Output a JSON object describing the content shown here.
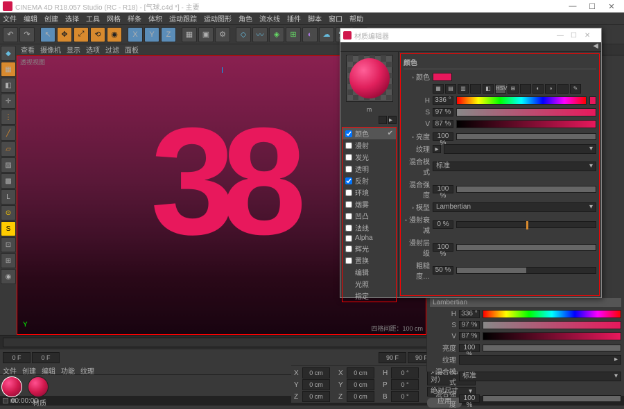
{
  "window": {
    "title": "CINEMA 4D R18.057 Studio (RC - R18) - [气球.c4d *] - 主要"
  },
  "menu": [
    "文件",
    "编辑",
    "创建",
    "选择",
    "工具",
    "网格",
    "样条",
    "体积",
    "运动跟踪",
    "运动图形",
    "角色",
    "流水线",
    "插件",
    "脚本",
    "窗口",
    "帮助"
  ],
  "viewport": {
    "tabs": [
      "查看",
      "摄像机",
      "显示",
      "选项",
      "过滤",
      "面板"
    ],
    "label": "透视视图",
    "frame_span": "四格间距：100 cm"
  },
  "timeline": {
    "start": "0 F",
    "current": "0 F",
    "end": "90 F",
    "end2": "90 F"
  },
  "materials": {
    "tabs": [
      "文件",
      "创建",
      "编辑",
      "功能",
      "纹理"
    ],
    "name1": "m",
    "name2": "材质"
  },
  "coords": {
    "x": "0 cm",
    "y": "0 cm",
    "z": "0 cm",
    "x2": "0 cm",
    "y2": "0 cm",
    "z2": "0 cm",
    "h": "0 °",
    "p": "0 °",
    "b": "0 °",
    "mode": "对象（相对）",
    "abs": "绝对尺寸",
    "apply": "应用"
  },
  "status": {
    "time": "00:00:00"
  },
  "mateditor": {
    "title": "材质编辑器",
    "preview_label": "m",
    "channels": [
      "颜色",
      "漫射",
      "发光",
      "透明",
      "反射",
      "环境",
      "烟雾",
      "凹凸",
      "法线",
      "Alpha",
      "辉光",
      "置换",
      "编辑",
      "光照",
      "指定"
    ],
    "section": "颜色",
    "color_label": "颜色",
    "h": {
      "lbl": "H",
      "val": "336 °"
    },
    "s": {
      "lbl": "S",
      "val": "97 %"
    },
    "v": {
      "lbl": "V",
      "val": "87 %"
    },
    "brightness": {
      "lbl": "亮度",
      "val": "100 %"
    },
    "texture": {
      "lbl": "纹理"
    },
    "blendmode": {
      "lbl": "混合模式",
      "val": "标准"
    },
    "blendstr": {
      "lbl": "混合强度",
      "val": "100 %"
    },
    "model": {
      "lbl": "模型",
      "val": "Lambertian"
    },
    "falloff": {
      "lbl": "漫射衰减",
      "val": "0 %"
    },
    "difflevel": {
      "lbl": "漫射层级",
      "val": "100 %"
    },
    "roughness": {
      "lbl": "粗糙度…",
      "val": "50 %"
    }
  },
  "attr": {
    "title": "Lambertian",
    "h": {
      "lbl": "H",
      "val": "336 °"
    },
    "s": {
      "lbl": "S",
      "val": "97 %"
    },
    "v": {
      "lbl": "V",
      "val": "87 %"
    },
    "brightness": {
      "lbl": "亮度",
      "val": "100 %"
    },
    "texture": {
      "lbl": "纹理"
    },
    "blendmode": {
      "lbl": "混合模式",
      "val": "标准"
    },
    "blendstr": {
      "lbl": "混合强度",
      "val": "100 %"
    }
  }
}
